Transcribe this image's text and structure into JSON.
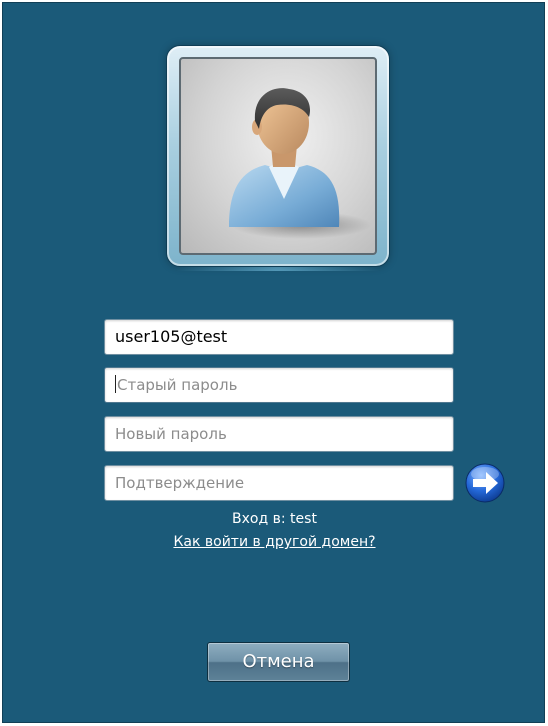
{
  "user_tile": {
    "icon": "user-avatar-icon"
  },
  "form": {
    "username_value": "user105@test",
    "old_password_placeholder": "Старый пароль",
    "new_password_placeholder": "Новый пароль",
    "confirm_placeholder": "Подтверждение",
    "submit_icon": "arrow-right-icon"
  },
  "login_to_text": "Вход в: test",
  "other_domain_link": "Как войти в другой домен?",
  "cancel_label": "Отмена",
  "colors": {
    "background": "#1b5a79",
    "go_button": "#1f5fd0"
  }
}
